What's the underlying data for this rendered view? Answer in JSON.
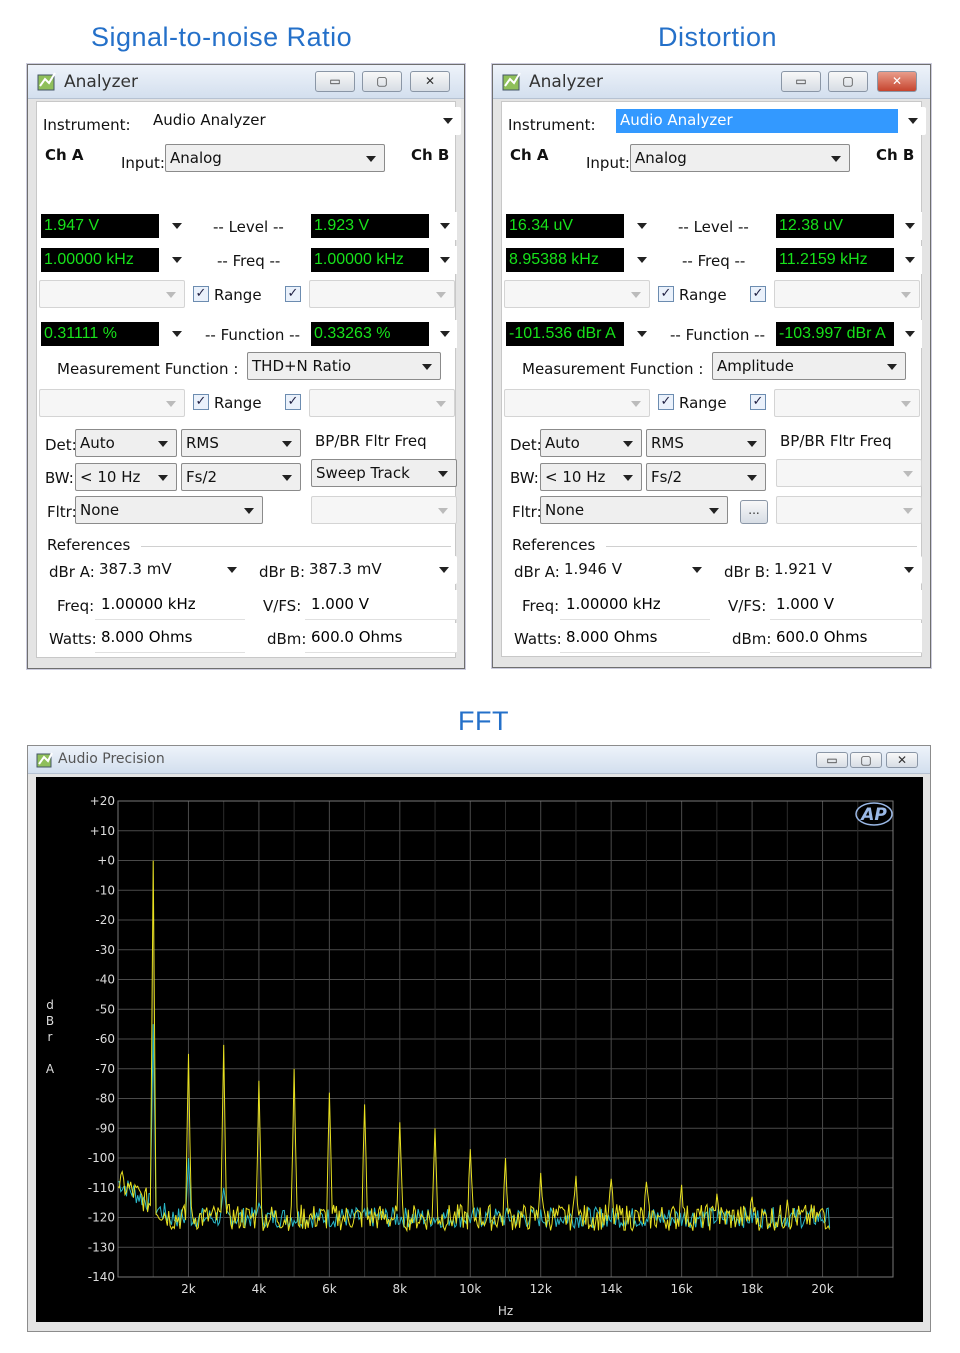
{
  "titles": {
    "snr": "Signal-to-noise Ratio",
    "dist": "Distortion",
    "fft": "FFT"
  },
  "windows": [
    {
      "app_title": "Analyzer",
      "instrument_label": "Instrument:",
      "instrument": "Audio Analyzer",
      "instrument_selected": false,
      "ch_a": "Ch A",
      "ch_b": "Ch B",
      "input_label": "Input:",
      "input": "Analog",
      "level_label": "-- Level --",
      "freq_label": "-- Freq --",
      "range_label": "Range",
      "function_label": "-- Function --",
      "level_a": "1.947   V",
      "level_b": "1.923   V",
      "freq_a": "1.00000 kHz",
      "freq_b": "1.00000 kHz",
      "func_a": "0.31111  %",
      "func_b": "0.33263  %",
      "mf_label": "Measurement Function :",
      "mf": "THD+N Ratio",
      "range2_label": "Range",
      "det_label": "Det:",
      "det": "Auto",
      "rms": "RMS",
      "bp_label": "BP/BR Fltr Freq",
      "bw_label": "BW:",
      "bw": "< 10 Hz",
      "fs": "Fs/2",
      "sweep": "Sweep Track",
      "fltr_label": "Fltr:",
      "fltr": "None",
      "extra_button": "",
      "refs_label": "References",
      "dbra_label": "dBr A:",
      "dbra": "387.3   mV",
      "dbrb_label": "dBr B:",
      "dbrb": "387.3   mV",
      "freq_ref_label": "Freq:",
      "freq_ref": "1.00000 kHz",
      "vfs_label": "V/FS:",
      "vfs": "1.000     V",
      "watts_label": "Watts:",
      "watts": "8.000     Ohms",
      "dbm_label": "dBm:",
      "dbm": "600.0     Ohms"
    },
    {
      "app_title": "Analyzer",
      "instrument_label": "Instrument:",
      "instrument": "Audio Analyzer",
      "instrument_selected": true,
      "ch_a": "Ch A",
      "ch_b": "Ch B",
      "input_label": "Input:",
      "input": "Analog",
      "level_label": "-- Level --",
      "freq_label": "-- Freq --",
      "range_label": "Range",
      "function_label": "-- Function --",
      "level_a": "16.34   uV",
      "level_b": "12.38   uV",
      "freq_a": "8.95388 kHz",
      "freq_b": "11.2159 kHz",
      "func_a": "-101.536 dBr A",
      "func_b": "-103.997 dBr A",
      "mf_label": "Measurement Function :",
      "mf": "Amplitude",
      "range2_label": "Range",
      "det_label": "Det:",
      "det": "Auto",
      "rms": "RMS",
      "bp_label": "BP/BR Fltr Freq",
      "bw_label": "BW:",
      "bw": "< 10 Hz",
      "fs": "Fs/2",
      "sweep": "",
      "fltr_label": "Fltr:",
      "fltr": "None",
      "extra_button": "...",
      "refs_label": "References",
      "dbra_label": "dBr A:",
      "dbra": "1.946     V",
      "dbrb_label": "dBr B:",
      "dbrb": "1.921     V",
      "freq_ref_label": "Freq:",
      "freq_ref": "1.00000 kHz",
      "vfs_label": "V/FS:",
      "vfs": "1.000     V",
      "watts_label": "Watts:",
      "watts": "8.000     Ohms",
      "dbm_label": "dBm:",
      "dbm": "600.0     Ohms"
    }
  ],
  "fft_window": {
    "app_title": "Audio Precision",
    "logo": "AP"
  },
  "chart_data": {
    "type": "line",
    "title": "",
    "xlabel": "Hz",
    "ylabel": "d B r  A",
    "xlim": [
      0,
      22000
    ],
    "ylim": [
      -140,
      20
    ],
    "x_ticks": [
      {
        "v": 2000,
        "l": "2k"
      },
      {
        "v": 4000,
        "l": "4k"
      },
      {
        "v": 6000,
        "l": "6k"
      },
      {
        "v": 8000,
        "l": "8k"
      },
      {
        "v": 10000,
        "l": "10k"
      },
      {
        "v": 12000,
        "l": "12k"
      },
      {
        "v": 14000,
        "l": "14k"
      },
      {
        "v": 16000,
        "l": "16k"
      },
      {
        "v": 18000,
        "l": "18k"
      },
      {
        "v": 20000,
        "l": "20k"
      }
    ],
    "y_ticks": [
      20,
      10,
      0,
      -10,
      -20,
      -30,
      -40,
      -50,
      -60,
      -70,
      -80,
      -90,
      -100,
      -110,
      -120,
      -130,
      -140
    ],
    "y_tick_labels": [
      "+20",
      "+10",
      "+0",
      "-10",
      "-20",
      "-30",
      "-40",
      "-50",
      "-60",
      "-70",
      "-80",
      "-90",
      "-100",
      "-110",
      "-120",
      "-130",
      "-140"
    ],
    "grid": true,
    "noise_floor_dbr": -120,
    "series": [
      {
        "color": "#e8e020",
        "peaks": [
          {
            "x": 1000,
            "y": 0
          },
          {
            "x": 2000,
            "y": -65
          },
          {
            "x": 3000,
            "y": -62
          },
          {
            "x": 4000,
            "y": -74
          },
          {
            "x": 5000,
            "y": -70
          },
          {
            "x": 6000,
            "y": -78
          },
          {
            "x": 7000,
            "y": -82
          },
          {
            "x": 8000,
            "y": -88
          },
          {
            "x": 9000,
            "y": -90
          },
          {
            "x": 10000,
            "y": -97
          },
          {
            "x": 11000,
            "y": -100
          },
          {
            "x": 12000,
            "y": -105
          },
          {
            "x": 13000,
            "y": -106
          },
          {
            "x": 14000,
            "y": -107
          },
          {
            "x": 15000,
            "y": -108
          },
          {
            "x": 16000,
            "y": -109
          },
          {
            "x": 17000,
            "y": -112
          },
          {
            "x": 18000,
            "y": -113
          },
          {
            "x": 19000,
            "y": -114
          },
          {
            "x": 20000,
            "y": -117
          }
        ]
      },
      {
        "color": "#2ab8c8",
        "peaks": [
          {
            "x": 1000,
            "y": -55
          },
          {
            "x": 2000,
            "y": -100
          },
          {
            "x": 3000,
            "y": -110
          },
          {
            "x": 4000,
            "y": -115
          }
        ]
      }
    ]
  }
}
